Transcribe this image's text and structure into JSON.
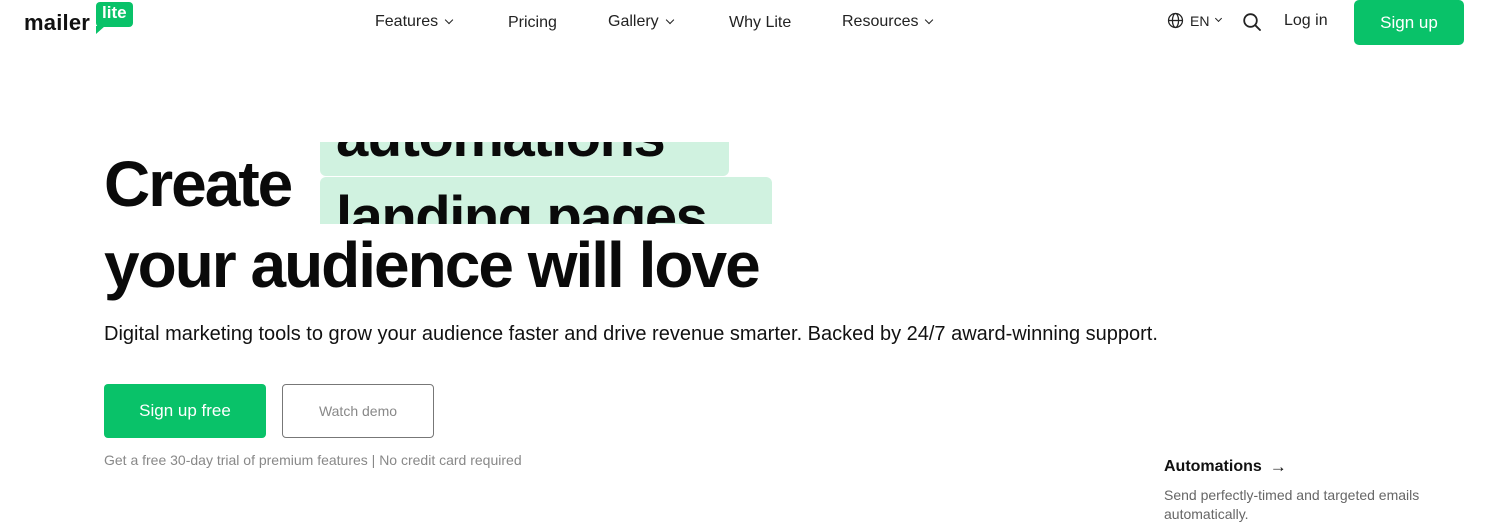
{
  "header": {
    "logo": {
      "word": "mailer",
      "badge": "lite"
    },
    "nav": [
      {
        "label": "Features",
        "dropdown": true
      },
      {
        "label": "Pricing",
        "dropdown": false
      },
      {
        "label": "Gallery",
        "dropdown": true
      },
      {
        "label": "Why Lite",
        "dropdown": false
      },
      {
        "label": "Resources",
        "dropdown": true
      }
    ],
    "language": {
      "label": "EN",
      "icon": "globe-icon"
    },
    "search_icon": "search-icon",
    "login_label": "Log in",
    "signup_label": "Sign up"
  },
  "hero": {
    "create_word": "Create",
    "rotating_words": [
      "automations",
      "landing pages"
    ],
    "line2": "your audience will love",
    "subtitle": "Digital marketing tools to grow your audience faster and drive revenue smarter. Backed by 24/7 award-winning support.",
    "cta_primary": "Sign up free",
    "cta_secondary": "Watch demo",
    "trial_note": "Get a free 30-day trial of premium features | No credit card required"
  },
  "feature_card": {
    "title": "Automations",
    "arrow": "→",
    "description": "Send perfectly-timed and targeted emails automatically."
  },
  "colors": {
    "brand_green": "#09c269",
    "highlight_mint": "#d0f2e0",
    "text_dark": "#111111",
    "text_muted": "#888888"
  }
}
